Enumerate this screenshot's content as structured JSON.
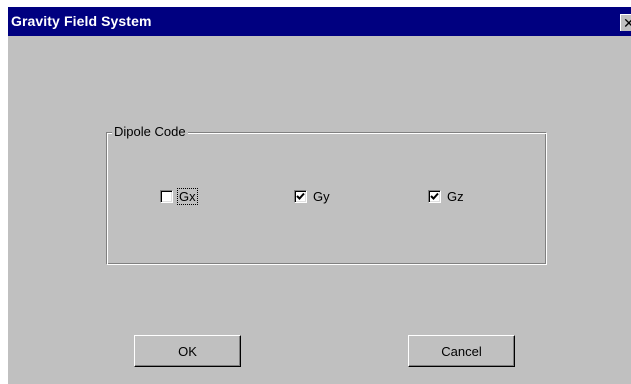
{
  "window": {
    "title": "Gravity Field System",
    "close_glyph": "✕",
    "close_icon": "close-icon"
  },
  "dipole_group": {
    "label": "Dipole Code",
    "options": [
      {
        "label": "Gx",
        "checked": false
      },
      {
        "label": "Gy",
        "checked": true
      },
      {
        "label": "Gz",
        "checked": true
      }
    ]
  },
  "buttons": {
    "ok_label": "OK",
    "cancel_label": "Cancel"
  },
  "colors": {
    "titlebar": "#000080",
    "face": "#c0c0c0"
  }
}
